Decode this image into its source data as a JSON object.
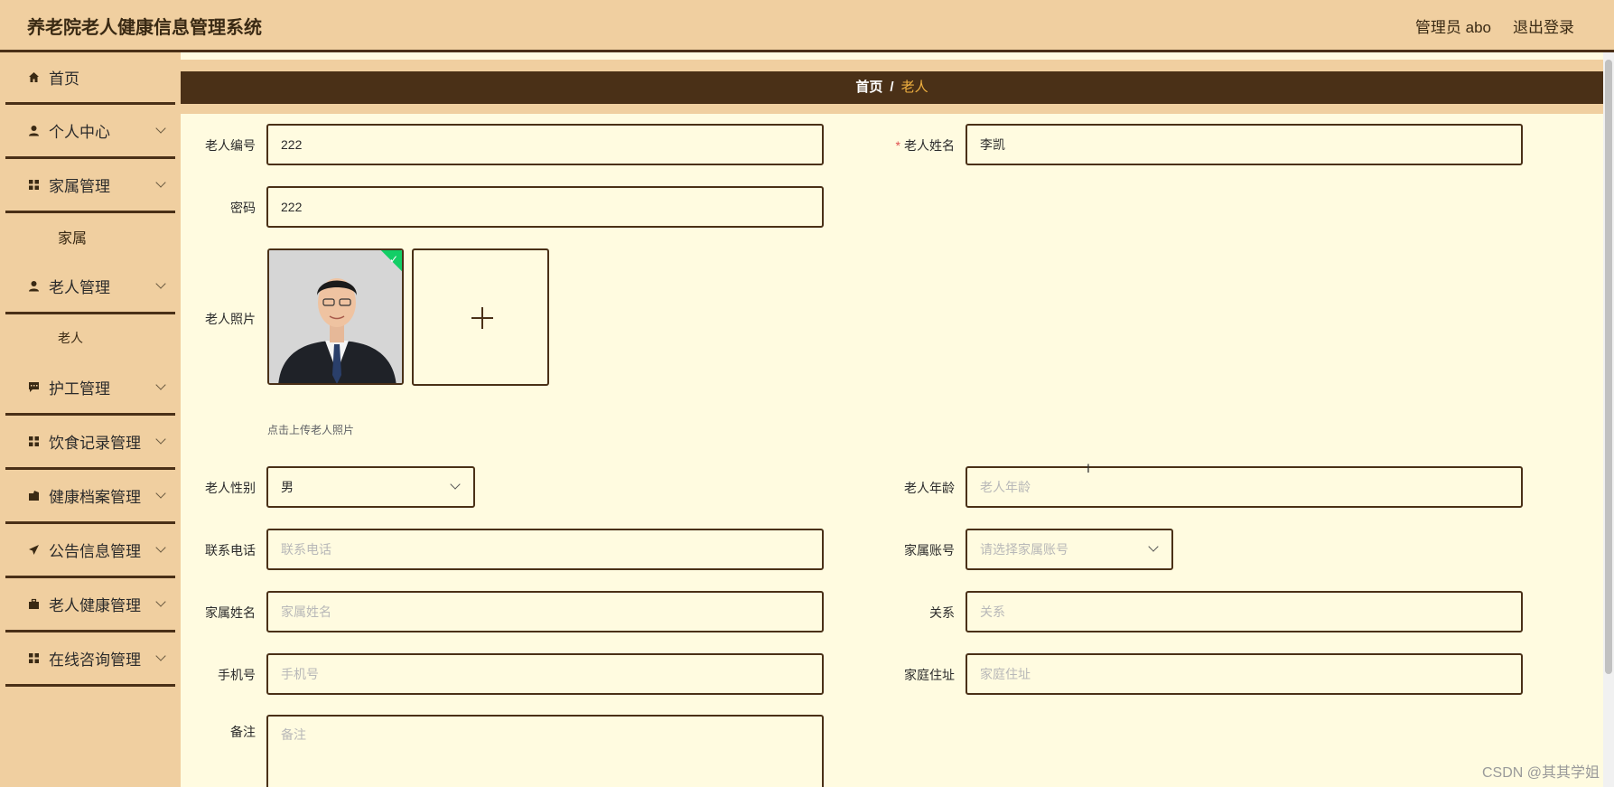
{
  "header": {
    "title": "养老院老人健康信息管理系统",
    "user": "管理员 abo",
    "logout": "退出登录"
  },
  "sidebar": {
    "items": [
      {
        "label": "首页",
        "icon": "home-icon"
      },
      {
        "label": "个人中心",
        "icon": "user-icon"
      },
      {
        "label": "家属管理",
        "icon": "grid-icon"
      },
      {
        "label": "家属",
        "sub": true
      },
      {
        "label": "老人管理",
        "icon": "user-icon"
      },
      {
        "label": "老人",
        "sub": true
      },
      {
        "label": "护工管理",
        "icon": "chat-icon"
      },
      {
        "label": "饮食记录管理",
        "icon": "grid-icon"
      },
      {
        "label": "健康档案管理",
        "icon": "folder-icon"
      },
      {
        "label": "公告信息管理",
        "icon": "send-icon"
      },
      {
        "label": "老人健康管理",
        "icon": "briefcase-icon"
      },
      {
        "label": "在线咨询管理",
        "icon": "grid-icon"
      }
    ]
  },
  "breadcrumb": {
    "home": "首页",
    "separator": "/",
    "current": "老人"
  },
  "form": {
    "elder_id": {
      "label": "老人编号",
      "value": "222"
    },
    "elder_name": {
      "label": "老人姓名",
      "value": "李凯",
      "required": "*"
    },
    "password": {
      "label": "密码",
      "value": "222"
    },
    "photo": {
      "label": "老人照片",
      "tip": "点击上传老人照片"
    },
    "gender": {
      "label": "老人性别",
      "value": "男"
    },
    "age": {
      "label": "老人年龄",
      "placeholder": "老人年龄"
    },
    "phone": {
      "label": "联系电话",
      "placeholder": "联系电话"
    },
    "family_account": {
      "label": "家属账号",
      "placeholder": "请选择家属账号"
    },
    "family_name": {
      "label": "家属姓名",
      "placeholder": "家属姓名"
    },
    "relation": {
      "label": "关系",
      "placeholder": "关系"
    },
    "mobile": {
      "label": "手机号",
      "placeholder": "手机号"
    },
    "address": {
      "label": "家庭住址",
      "placeholder": "家庭住址"
    },
    "remark": {
      "label": "备注",
      "placeholder": "备注"
    }
  },
  "watermark": "CSDN @其其学姐",
  "colors": {
    "bar": "#f0cfa0",
    "dark": "#4a3017",
    "content_bg": "#fffbe0",
    "accent": "#f0b040",
    "success": "#13ce66"
  }
}
